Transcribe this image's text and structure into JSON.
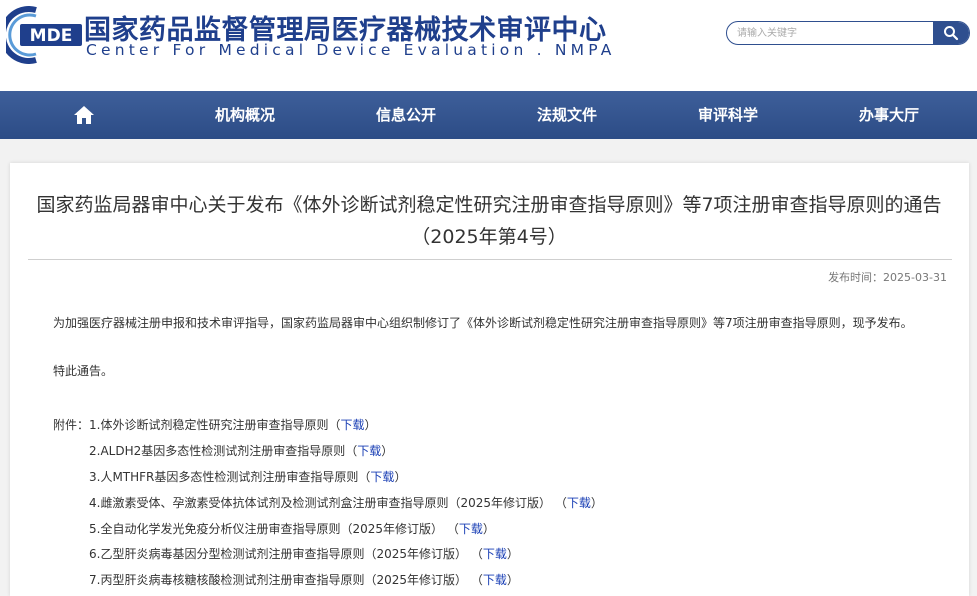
{
  "header": {
    "logo_text": "MDE",
    "title_cn": "国家药品监督管理局医疗器械技术审评中心",
    "title_en": "Center For Medical Device Evaluation . NMPA"
  },
  "search": {
    "placeholder": "请输入关键字",
    "icon": "search-icon"
  },
  "nav": {
    "home_icon": "home-icon",
    "items": [
      "机构概况",
      "信息公开",
      "法规文件",
      "审评科学",
      "办事大厅"
    ]
  },
  "article": {
    "title": "国家药监局器审中心关于发布《体外诊断试剂稳定性研究注册审查指导原则》等7项注册审查指导原则的通告（2025年第4号）",
    "date": "发布时间：2025-03-31",
    "paragraph": "为加强医疗器械注册申报和技术审评指导，国家药监局器审中心组织制修订了《体外诊断试剂稳定性研究注册审查指导原则》等7项注册审查指导原则，现予发布。",
    "notice": "特此通告。",
    "attach_prefix": "附件：",
    "attachments": [
      {
        "name": "1.体外诊断试剂稳定性研究注册审查指导原则",
        "paren_open": "（",
        "link": "下载",
        "paren_close": "）"
      },
      {
        "name": "2.ALDH2基因多态性检测试剂注册审查指导原则",
        "paren_open": "（",
        "link": "下载",
        "paren_close": "）"
      },
      {
        "name": "3.人MTHFR基因多态性检测试剂注册审查指导原则",
        "paren_open": "（",
        "link": "下载",
        "paren_close": "）"
      },
      {
        "name": "4.雌激素受体、孕激素受体抗体试剂及检测试剂盒注册审查指导原则（2025年修订版）",
        "paren_open": " （",
        "link": "下载",
        "paren_close": "）"
      },
      {
        "name": "5.全自动化学发光免疫分析仪注册审查指导原则（2025年修订版）",
        "paren_open": " （",
        "link": "下载",
        "paren_close": "）"
      },
      {
        "name": "6.乙型肝炎病毒基因分型检测试剂注册审查指导原则（2025年修订版）",
        "paren_open": " （",
        "link": "下载",
        "paren_close": "）"
      },
      {
        "name": "7.丙型肝炎病毒核糖核酸检测试剂注册审查指导原则（2025年修订版）",
        "paren_open": " （",
        "link": "下载",
        "paren_close": "）"
      }
    ]
  },
  "colors": {
    "brand_blue": "#1f3f8c",
    "nav_bg": "#34558f",
    "link_blue": "#1a3fb5"
  }
}
